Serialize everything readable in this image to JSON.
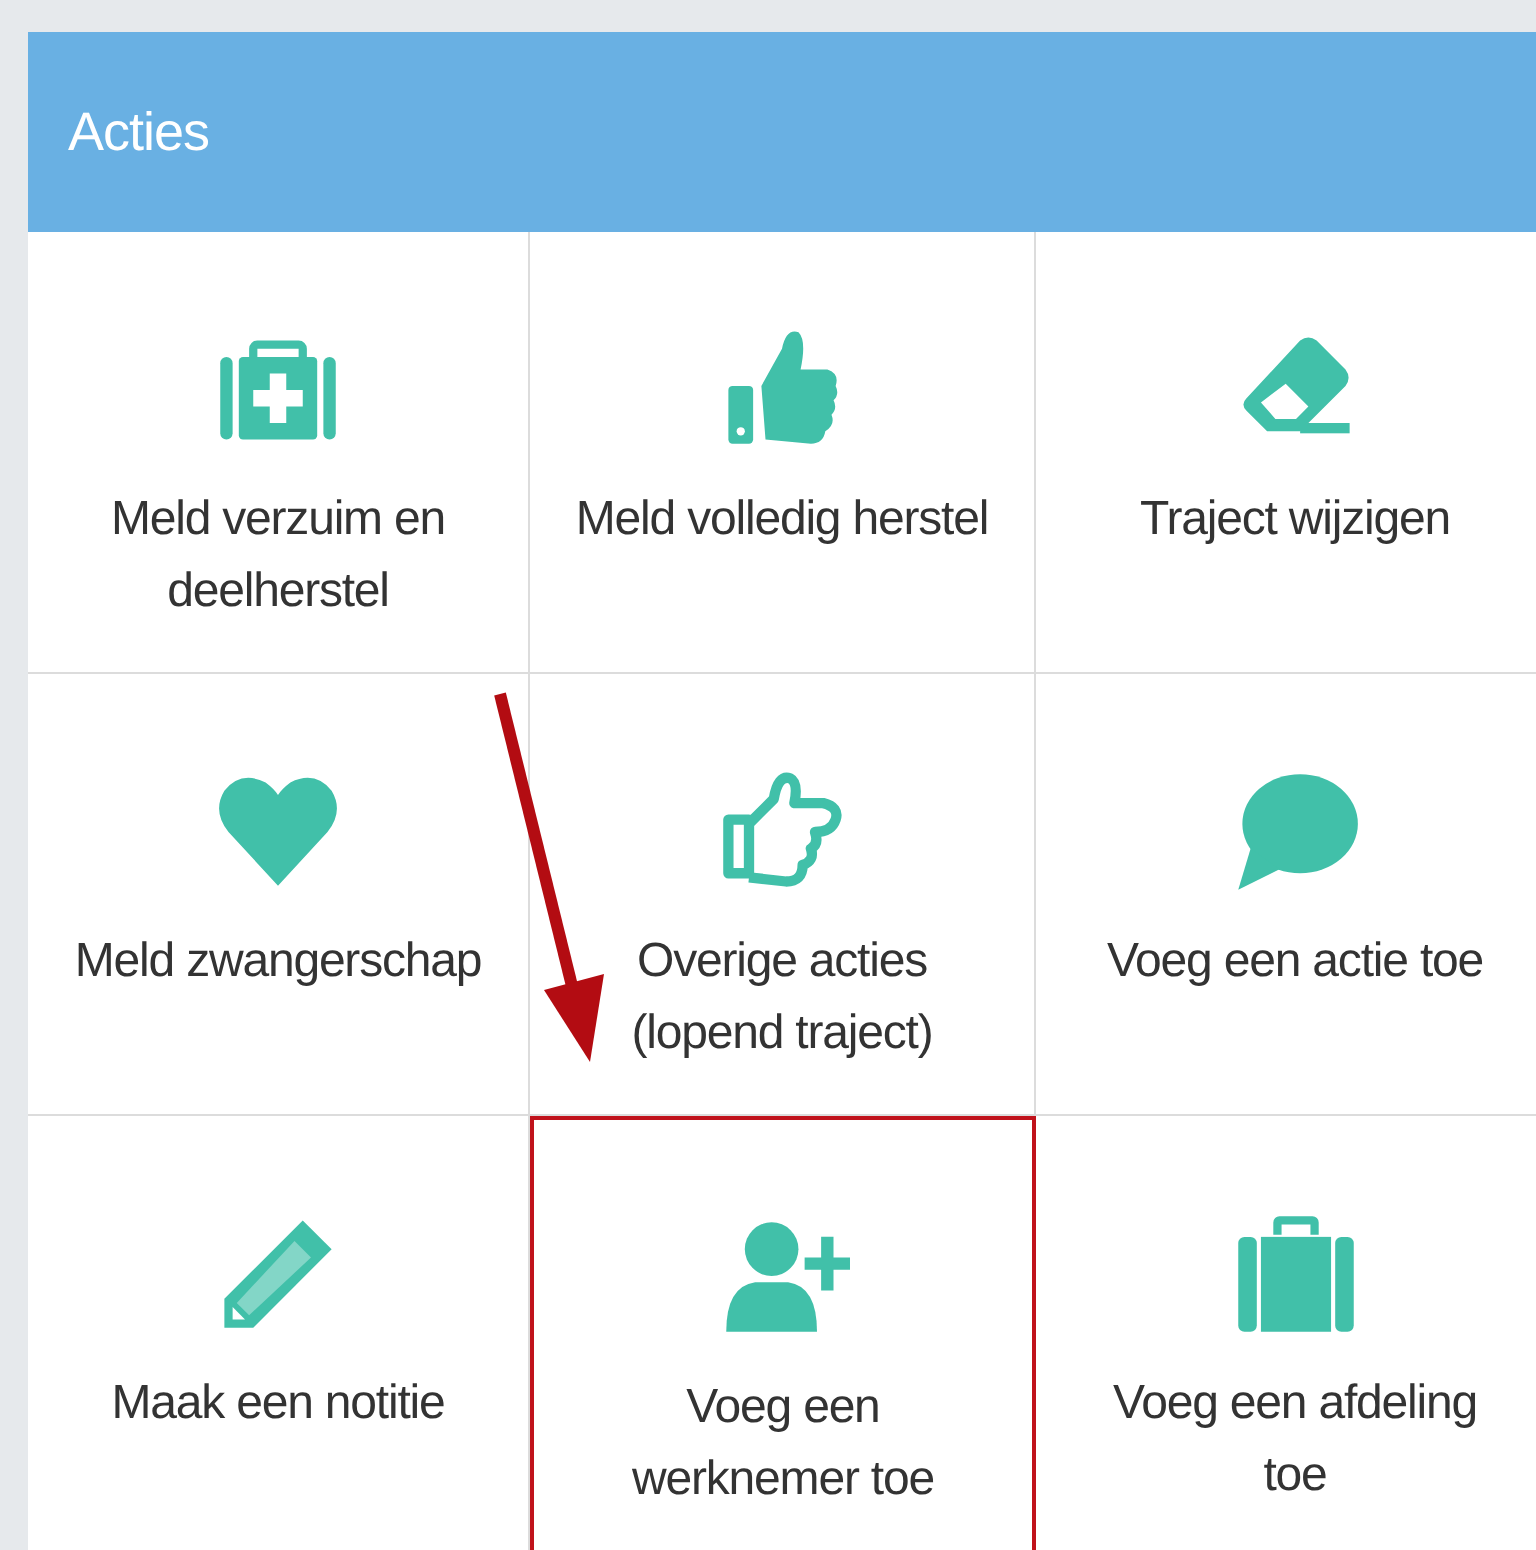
{
  "panel": {
    "title": "Acties"
  },
  "actions": [
    {
      "label": "Meld verzuim en deelherstel",
      "highlighted": false
    },
    {
      "label": "Meld volledig herstel",
      "highlighted": false
    },
    {
      "label": "Traject wijzigen",
      "highlighted": false
    },
    {
      "label": "Meld zwangerschap",
      "highlighted": false
    },
    {
      "label": "Overige acties (lopend traject)",
      "highlighted": false
    },
    {
      "label": "Voeg een actie toe",
      "highlighted": false
    },
    {
      "label": "Maak een notitie",
      "highlighted": false
    },
    {
      "label": "Voeg een werknemer toe",
      "highlighted": true
    },
    {
      "label": "Voeg een afdeling toe",
      "highlighted": false
    }
  ]
}
